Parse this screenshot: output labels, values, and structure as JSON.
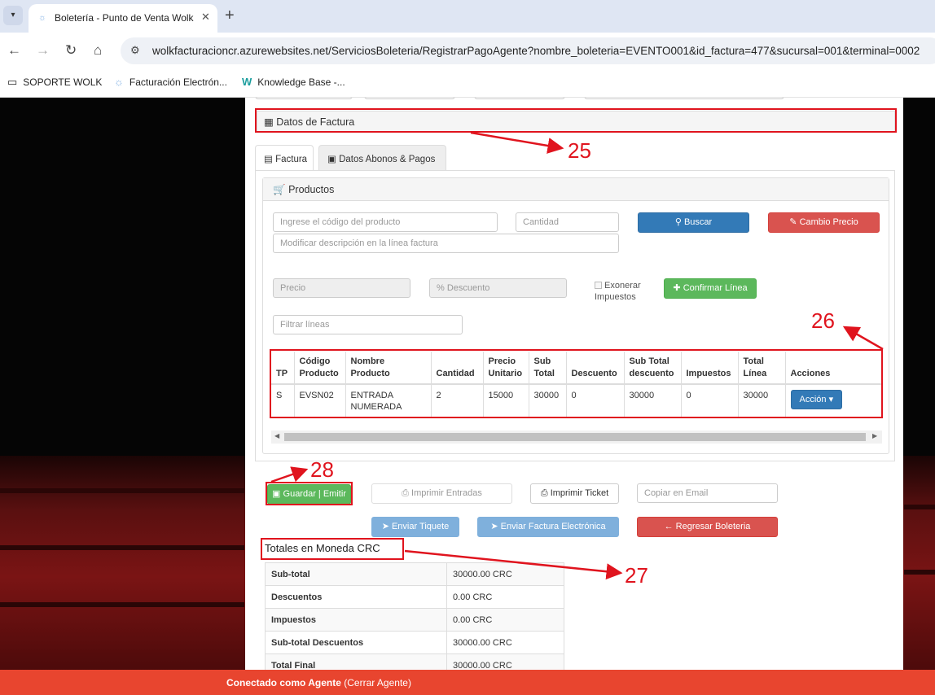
{
  "browser": {
    "tab_title": "Boletería - Punto de Venta Wolk",
    "url": "wolkfacturacioncr.azurewebsites.net/ServiciosBoleteria/RegistrarPagoAgente?nombre_boleteria=EVENTO001&id_factura=477&sucursal=001&terminal=0002",
    "bookmarks": [
      {
        "label": "SOPORTE WOLK",
        "icon": "folder-icon"
      },
      {
        "label": "Facturación Electrón...",
        "icon": "favicon-icon"
      },
      {
        "label": "Knowledge Base -...",
        "icon": "w-logo-icon"
      }
    ]
  },
  "section": {
    "title": "Datos de Factura"
  },
  "tabs": [
    {
      "label": "Factura",
      "icon": "file-icon",
      "active": true
    },
    {
      "label": "Datos Abonos & Pagos",
      "icon": "money-icon",
      "active": false
    }
  ],
  "products": {
    "title": "Productos",
    "code_placeholder": "Ingrese el código del producto",
    "qty_placeholder": "Cantidad",
    "desc_placeholder": "Modificar descripción en la línea factura",
    "price_placeholder": "Precio",
    "discount_placeholder": "% Descuento",
    "exonerate_label": "Exonerar Impuestos",
    "filter_placeholder": "Filtrar líneas",
    "search_button": "Buscar",
    "change_price_button": "Cambio Precio",
    "confirm_button": "Confirmar Línea",
    "columns": [
      "TP",
      "Código Producto",
      "Nombre Producto",
      "Cantidad",
      "Precio Unitario",
      "Sub Total",
      "Descuento",
      "Sub Total descuento",
      "Impuestos",
      "Total Línea",
      "Acciones"
    ],
    "rows": [
      {
        "tp": "S",
        "codigo": "EVSN02",
        "nombre": "ENTRADA NUMERADA",
        "cantidad": "2",
        "precio": "15000",
        "subtotal": "30000",
        "descuento": "0",
        "subtotal_desc": "30000",
        "impuestos": "0",
        "total": "30000",
        "accion": "Acción"
      }
    ]
  },
  "actions": {
    "save": "Guardar | Emitir",
    "print_entries": "Imprimir Entradas",
    "print_ticket": "Imprimir Ticket",
    "email_placeholder": "Copiar en Email",
    "send_ticket": "Enviar Tiquete",
    "send_invoice": "Enviar Factura Electrónica",
    "back": "Regresar Boleteria"
  },
  "totals": {
    "title": "Totales en Moneda CRC",
    "rows": [
      {
        "label": "Sub-total",
        "value": "30000.00 CRC"
      },
      {
        "label": "Descuentos",
        "value": "0.00 CRC"
      },
      {
        "label": "Impuestos",
        "value": "0.00 CRC"
      },
      {
        "label": "Sub-total Descuentos",
        "value": "30000.00 CRC"
      },
      {
        "label": "Total Final",
        "value": "30000.00 CRC"
      }
    ]
  },
  "annotations": [
    "25",
    "26",
    "27",
    "28"
  ],
  "footer": {
    "connected": "Conectado como Agente",
    "close": "(Cerrar Agente)"
  },
  "colors": {
    "annotation": "#e0141e",
    "footer": "#e8452f",
    "primary": "#337ab7",
    "danger": "#d9534f",
    "success": "#5cb85c"
  }
}
